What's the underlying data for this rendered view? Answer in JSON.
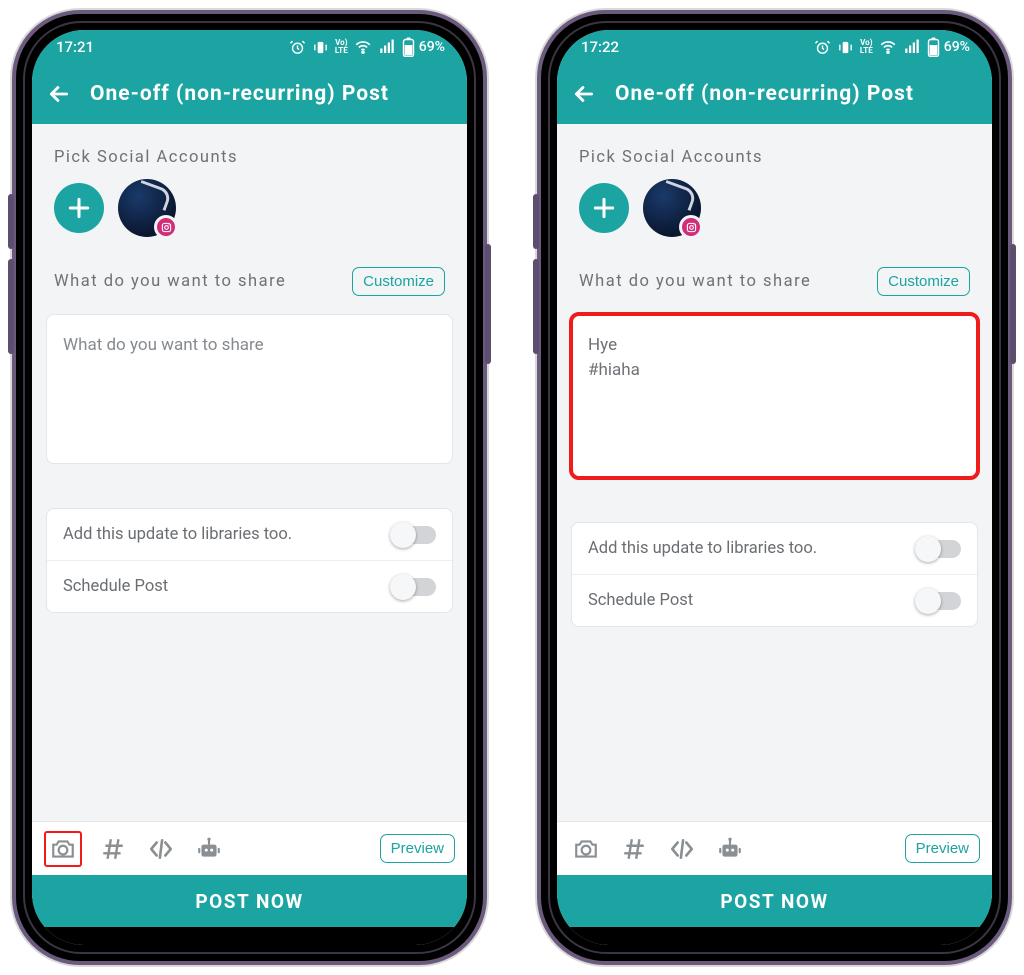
{
  "phones": [
    {
      "status": {
        "time": "17:21",
        "battery": "69%",
        "icons": [
          "alarm",
          "vibrate",
          "volte",
          "wifi",
          "signal",
          "battery"
        ]
      },
      "header": {
        "title": "One-off (non-recurring) Post"
      },
      "pick_label": "Pick Social Accounts",
      "share_label": "What do you want to share",
      "customize_label": "Customize",
      "textarea": {
        "placeholder": "What do you want to share",
        "value": "",
        "highlighted": false
      },
      "options": {
        "libraries": "Add this update to libraries too.",
        "schedule": "Schedule Post"
      },
      "toolbar": {
        "camera_highlight": true,
        "preview": "Preview"
      },
      "post_now": "POST NOW"
    },
    {
      "status": {
        "time": "17:22",
        "battery": "69%",
        "icons": [
          "alarm",
          "vibrate",
          "volte",
          "wifi",
          "signal",
          "battery"
        ]
      },
      "header": {
        "title": "One-off (non-recurring) Post"
      },
      "pick_label": "Pick Social Accounts",
      "share_label": "What do you want to share",
      "customize_label": "Customize",
      "textarea": {
        "placeholder": "",
        "value": "Hye\n#hiaha",
        "highlighted": true
      },
      "options": {
        "libraries": "Add this update to libraries too.",
        "schedule": "Schedule Post"
      },
      "toolbar": {
        "camera_highlight": false,
        "preview": "Preview"
      },
      "post_now": "POST NOW"
    }
  ],
  "colors": {
    "accent": "#1ba4a2",
    "highlight": "#f01b1b",
    "badge": "#d12e79"
  }
}
